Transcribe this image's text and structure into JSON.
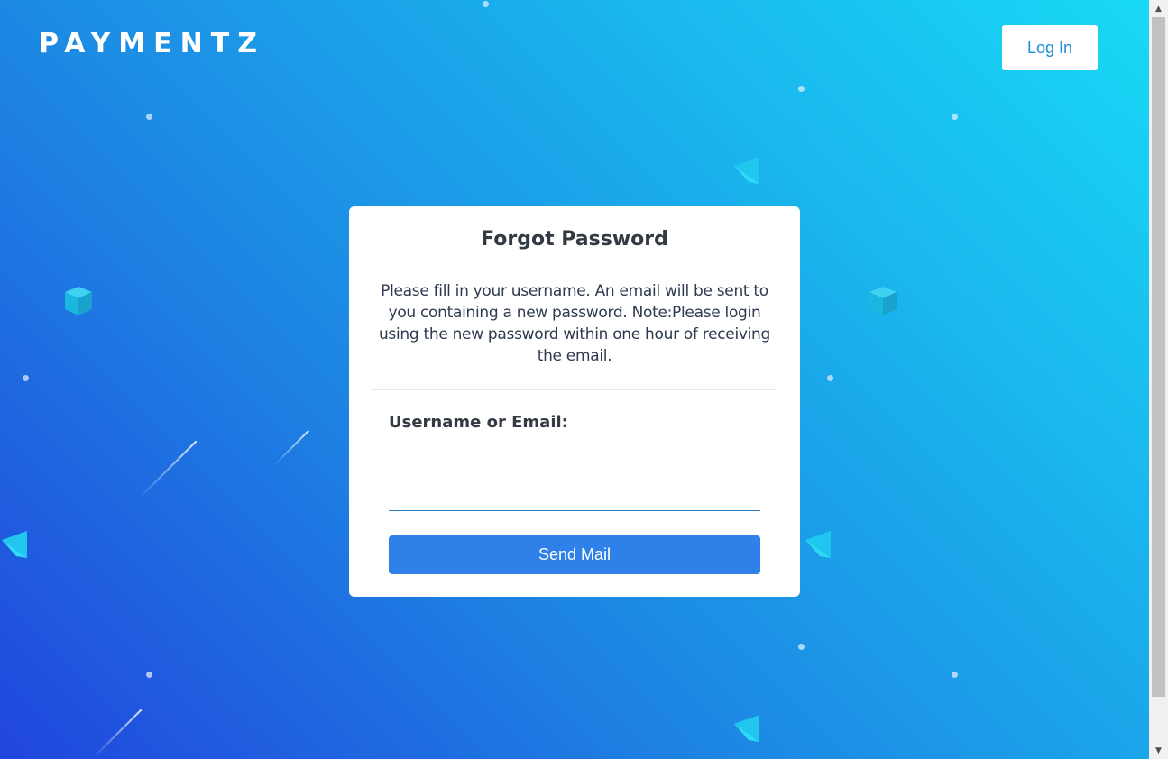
{
  "header": {
    "logo_text": "PAYMENTZ",
    "login_label": "Log In"
  },
  "card": {
    "title": "Forgot Password",
    "description": "Please fill in your username. An email will be sent to you containing a new password. Note:Please login using the new password within one hour of receiving the email.",
    "field_label": "Username or Email:",
    "field_value": "",
    "field_placeholder": "",
    "send_label": "Send Mail"
  },
  "colors": {
    "gradient_top_right": "#18d9f5",
    "gradient_bottom_left": "#2146dd",
    "primary_button": "#2f80e8",
    "login_text": "#1a8fd6"
  },
  "icons": {
    "scroll_up": "▲",
    "scroll_down": "▼"
  }
}
